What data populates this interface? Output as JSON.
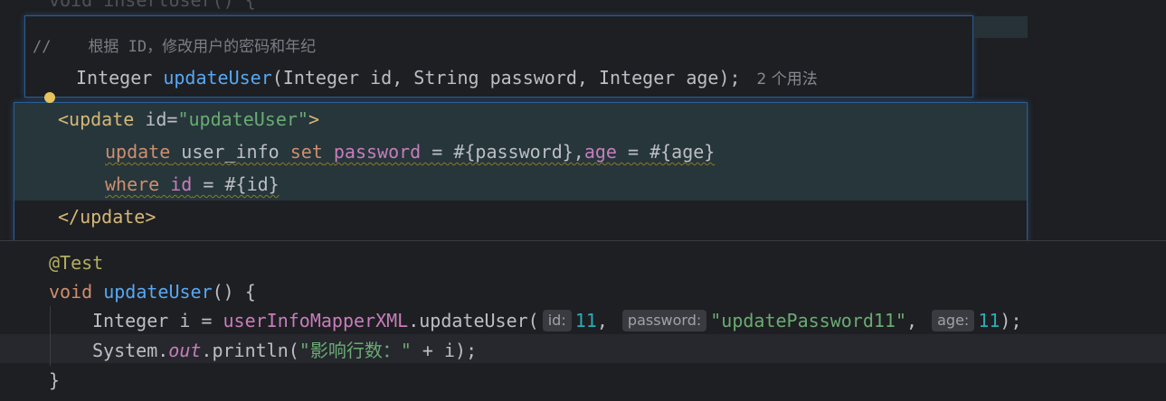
{
  "top_ghost": "void insertUser() {",
  "interface_popup": {
    "comment_prefix": "//",
    "comment_text": "根据 ID，修改用户的密码和年纪",
    "return_type": "Integer",
    "method": "updateUser",
    "params": "(Integer id, String password, Integer age);",
    "usages": "2 个用法"
  },
  "xml_popup": {
    "open_tag_start": "<update",
    "attr_name": " id=",
    "attr_value": "\"updateUser\"",
    "open_tag_end": ">",
    "sql1": {
      "kw_update": "update",
      "table": " user_info ",
      "kw_set": "set",
      "space": " ",
      "col_password": "password",
      "assign1": " = #{password},",
      "col_age": "age",
      "assign2": " = #{age}"
    },
    "sql2": {
      "kw_where": "where",
      "space": " ",
      "col_id": "id",
      "assign": " = #{id}"
    },
    "close_tag": "</update>"
  },
  "editor": {
    "annotation": "@Test",
    "kw_void": "void",
    "method": "updateUser",
    "method_rest": "() {",
    "line3": {
      "type": "Integer",
      "var": " i = ",
      "field": "userInfoMapperXML",
      "call": ".updateUser(",
      "hint_id": "id:",
      "val_id": "11",
      "sep1": ", ",
      "hint_password": "password:",
      "val_password": "\"updatePassword11\"",
      "sep2": ", ",
      "hint_age": "age:",
      "val_age": "11",
      "end": ");"
    },
    "line4": {
      "system": "System.",
      "out": "out",
      "println": ".println(",
      "str": "\"影响行数：\"",
      "rest": " + i);"
    },
    "close_brace": "}"
  }
}
